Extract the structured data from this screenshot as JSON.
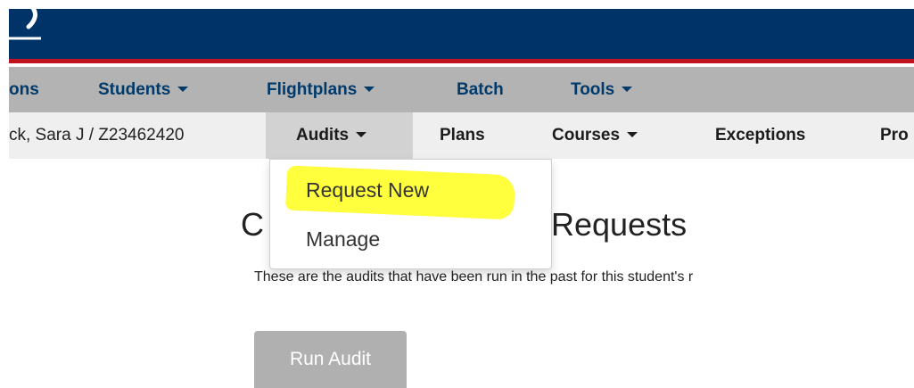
{
  "nav_primary": {
    "items": [
      {
        "label": "ons",
        "has_caret": false
      },
      {
        "label": "Students",
        "has_caret": true
      },
      {
        "label": "Flightplans",
        "has_caret": true
      },
      {
        "label": "Batch",
        "has_caret": false
      },
      {
        "label": "Tools",
        "has_caret": true
      }
    ]
  },
  "nav_secondary": {
    "student": "ck, Sara J / Z23462420",
    "items": [
      {
        "label": "Audits",
        "has_caret": true,
        "active": true
      },
      {
        "label": "Plans",
        "has_caret": false
      },
      {
        "label": "Courses",
        "has_caret": true
      },
      {
        "label": "Exceptions",
        "has_caret": false
      },
      {
        "label": "Pro",
        "has_caret": false
      }
    ]
  },
  "audits_menu": {
    "options": [
      "Request New",
      "Manage"
    ],
    "highlighted": "Request New"
  },
  "main": {
    "title_left": "C",
    "title_right": "Requests",
    "description": "These are the audits that have been run in the past for this student's r",
    "run_audit_label": "Run Audit"
  },
  "colors": {
    "header": "#003469",
    "accent_red": "#c1121f",
    "highlight": "#ffff1c"
  }
}
